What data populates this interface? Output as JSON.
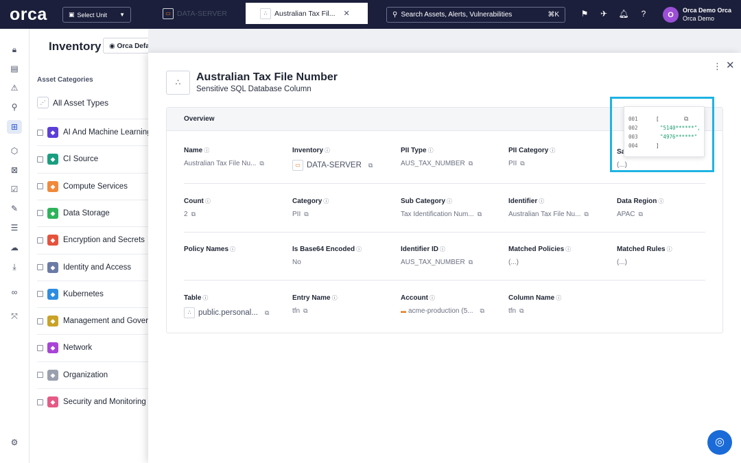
{
  "topbar": {
    "logo": "orca",
    "unit_select": "Select Unit",
    "search_placeholder": "Search Assets, Alerts, Vulnerabilities",
    "search_shortcut": "⌘K",
    "user_initial": "O",
    "user_name": "Orca Demo Orca",
    "user_org": "Orca Demo"
  },
  "inventory": {
    "title": "Inventory",
    "view_button": "Orca Default",
    "categories_heading": "Asset Categories",
    "all_types": "All Asset Types",
    "categories": [
      {
        "label": "AI And Machine Learning",
        "color": "#5b3fd6",
        "icon": "ai-icon"
      },
      {
        "label": "CI Source",
        "color": "#1a9e80",
        "icon": "ci-icon"
      },
      {
        "label": "Compute Services",
        "color": "#f08a3c",
        "icon": "compute-icon"
      },
      {
        "label": "Data Storage",
        "color": "#2fb35a",
        "icon": "storage-icon"
      },
      {
        "label": "Encryption and Secrets",
        "color": "#e5533d",
        "icon": "encryption-icon"
      },
      {
        "label": "Identity and Access",
        "color": "#6b7ba6",
        "icon": "identity-icon"
      },
      {
        "label": "Kubernetes",
        "color": "#2d8de0",
        "icon": "kubernetes-icon"
      },
      {
        "label": "Management and Governance",
        "color": "#c9a227",
        "icon": "management-icon"
      },
      {
        "label": "Network",
        "color": "#a745d6",
        "icon": "network-icon"
      },
      {
        "label": "Organization",
        "color": "#9aa0ae",
        "icon": "organization-icon"
      },
      {
        "label": "Security and Monitoring",
        "color": "#e55a86",
        "icon": "security-icon"
      }
    ]
  },
  "tabs": [
    {
      "label": "DATA-SERVER"
    },
    {
      "label": "Australian Tax Fil..."
    }
  ],
  "asset": {
    "title": "Australian Tax File Number",
    "subtitle": "Sensitive SQL Database Column"
  },
  "overview": {
    "heading": "Overview",
    "rows": [
      [
        {
          "label": "Name",
          "value": "Australian Tax File Nu..."
        },
        {
          "label": "Inventory",
          "value": "DATA-SERVER"
        },
        {
          "label": "PII Type",
          "value": "AUS_TAX_NUMBER"
        },
        {
          "label": "PII Category",
          "value": "PII"
        }
      ],
      [
        {
          "label": "Count",
          "value": "2"
        },
        {
          "label": "Category",
          "value": "PII"
        },
        {
          "label": "Sub Category",
          "value": "Tax Identification Num..."
        },
        {
          "label": "Identifier",
          "value": "Australian Tax File Nu..."
        },
        {
          "label": "Data Region",
          "value": "APAC"
        }
      ],
      [
        {
          "label": "Policy Names",
          "value": ""
        },
        {
          "label": "Is Base64 Encoded",
          "value": "No"
        },
        {
          "label": "Identifier ID",
          "value": "AUS_TAX_NUMBER"
        },
        {
          "label": "Matched Policies",
          "value": "(...)"
        },
        {
          "label": "Matched Rules",
          "value": "(...)"
        }
      ],
      [
        {
          "label": "Table",
          "value": "public.personal..."
        },
        {
          "label": "Entry Name",
          "value": "tfn"
        },
        {
          "label": "Account",
          "value": "acme-production (5..."
        },
        {
          "label": "Column Name",
          "value": "tfn"
        }
      ]
    ],
    "peek_label": "Sa",
    "peek_value": "(...)"
  },
  "popup": {
    "lines": [
      "001",
      "002",
      "003",
      "004"
    ],
    "code": [
      "[",
      "\"5140******\",",
      "\"4976******\"",
      "]"
    ]
  }
}
